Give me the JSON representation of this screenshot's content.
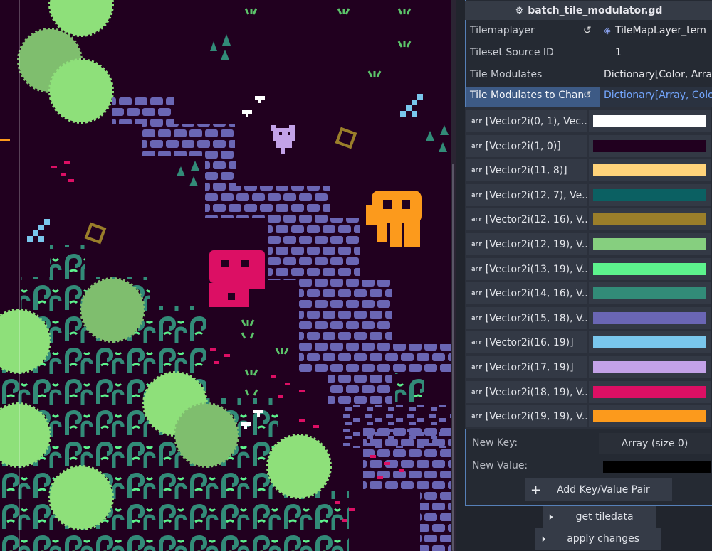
{
  "inspector": {
    "script_title": "batch_tile_modulator.gd",
    "properties": [
      {
        "label": "Tilemaplayer",
        "value": "TileMapLayer_tem",
        "has_revert": true,
        "has_node_icon": true
      },
      {
        "label": "Tileset Source ID",
        "value": "1"
      },
      {
        "label": "Tile Modulates",
        "value": "Dictionary[Color, Array"
      },
      {
        "label": "Tile Modulates to Chan",
        "value": "Dictionary[Array, Color",
        "has_revert": true,
        "selected": true
      }
    ],
    "dict_entries": [
      {
        "key": "[Vector2i(0, 1), Vec...",
        "color": "#ffffff"
      },
      {
        "key": "[Vector2i(1, 0)]",
        "color": "#21001f"
      },
      {
        "key": "[Vector2i(11, 8)]",
        "color": "#ffd37a"
      },
      {
        "key": "[Vector2i(12, 7), Ve...",
        "color": "#0b6062"
      },
      {
        "key": "[Vector2i(12, 16), V...",
        "color": "#9a7e2a"
      },
      {
        "key": "[Vector2i(12, 19), V...",
        "color": "#86cf7f"
      },
      {
        "key": "[Vector2i(13, 19), V...",
        "color": "#5df38d"
      },
      {
        "key": "[Vector2i(14, 16), V...",
        "color": "#328b78"
      },
      {
        "key": "[Vector2i(15, 18), V...",
        "color": "#6a66b4"
      },
      {
        "key": "[Vector2i(16, 19)]",
        "color": "#79c6ec"
      },
      {
        "key": "[Vector2i(17, 19)]",
        "color": "#c3a2e8"
      },
      {
        "key": "[Vector2i(18, 19), V...",
        "color": "#dc0f64"
      },
      {
        "key": "[Vector2i(19, 19), V...",
        "color": "#fc9a1c"
      }
    ],
    "new_key_label": "New Key:",
    "new_key_value": "Array (size 0)",
    "new_value_label": "New Value:",
    "new_value_color": "#000000",
    "add_pair_label": "Add Key/Value Pair",
    "buttons": {
      "get_tiledata": "get tiledata",
      "apply_changes": "apply changes"
    }
  },
  "icons": {
    "arr": "arr",
    "revert": "↺",
    "gear": "⚙",
    "node": "◈",
    "plus": "+",
    "speaker": "🕨"
  },
  "palette": {
    "bg": "#21001f",
    "bush_light": "#8ee07a",
    "bush_mid": "#7fbe6e",
    "brick": "#6a66b4",
    "vine": "#328b78",
    "vine_bright": "#5df38d",
    "orange": "#fc9a1c",
    "magenta": "#dc0f64",
    "lavender": "#c3a2e8",
    "sky": "#79c6ec",
    "gold": "#9a7e2a"
  }
}
